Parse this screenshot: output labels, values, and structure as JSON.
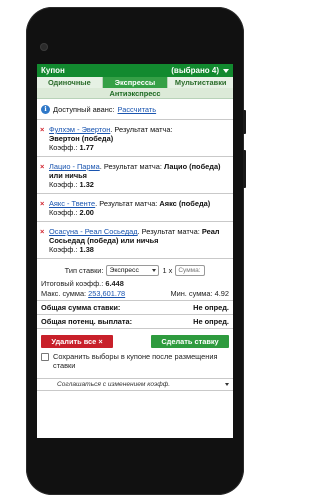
{
  "header": {
    "title": "Купон",
    "count_label": "(выбрано 4)"
  },
  "tabs": [
    {
      "label": "Одиночные",
      "active": false
    },
    {
      "label": "Экспрессы",
      "active": true
    },
    {
      "label": "Мультиставки",
      "active": false
    }
  ],
  "subtitle": "Антиэкспресс",
  "advance": {
    "label": "Доступный аванс:",
    "link": "Рассчитать"
  },
  "bets": [
    {
      "match": "Фулхэм - Эвертон",
      "result_prefix": ". Результат матча:",
      "pick": "Эвертон (победа)",
      "koef_label": "Коэфф.:",
      "koef": "1.77"
    },
    {
      "match": "Лацио - Парма",
      "result_prefix": ". Результат матча:",
      "pick": "Лацио (победа) или ничья",
      "koef_label": "Коэфф.:",
      "koef": "1.32"
    },
    {
      "match": "Аякс - Твенте",
      "result_prefix": ". Результат матча:",
      "pick": "Аякс (победа)",
      "koef_label": "Коэфф.:",
      "koef": "2.00"
    },
    {
      "match": "Осасуна - Реал Сосьедад",
      "result_prefix": ". Результат матча:",
      "pick": "Реал Сосьедад (победа) или ничья",
      "koef_label": "Коэфф.:",
      "koef": "1.38"
    }
  ],
  "params": {
    "type_label": "Тип ставки:",
    "type_value": "Экспресс",
    "multiplier": "1 x",
    "sum_placeholder": "Сумма:",
    "total_koef_label": "Итоговый коэфф.:",
    "total_koef": "6.448",
    "max_label": "Макс. сумма:",
    "max_value": "253,601.78",
    "min_label": "Мин. сумма:",
    "min_value": "4.92"
  },
  "totals": {
    "total_bet_label": "Общая сумма ставки:",
    "total_bet_value": "Не опред.",
    "total_payout_label": "Общая потенц. выплата:",
    "total_payout_value": "Не опред."
  },
  "buttons": {
    "delete_all": "Удалить все",
    "make_bet": "Сделать ставку"
  },
  "save_option": "Сохранить выборы в купоне после размещения ставки",
  "agree_option": "Соглашаться с изменением коэфф.",
  "colors": {
    "header_green": "#128a2f",
    "tab_active": "#35a046",
    "delete_red": "#c8202a",
    "bet_green": "#2e9b3e",
    "link_blue": "#1a55b0"
  }
}
